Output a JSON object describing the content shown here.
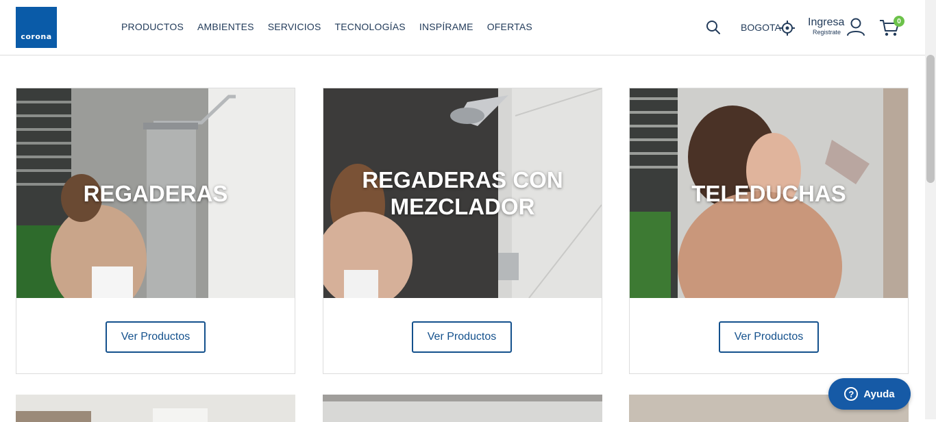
{
  "brand": {
    "logo_text": "corona",
    "color": "#0a5ba8"
  },
  "nav": [
    {
      "label": "PRODUCTOS"
    },
    {
      "label": "AMBIENTES"
    },
    {
      "label": "SERVICIOS"
    },
    {
      "label": "TECNOLOGÍAS"
    },
    {
      "label": "INSPÍRAME"
    },
    {
      "label": "OFERTAS"
    }
  ],
  "header": {
    "city": "BOGOTA",
    "login_label": "Ingresa",
    "register_label": "Registrate",
    "cart_count": "0",
    "icons": [
      "search-icon",
      "location-target-icon",
      "user-icon",
      "cart-icon"
    ]
  },
  "cards": [
    {
      "title": "REGADERAS",
      "button": "Ver Productos"
    },
    {
      "title": "REGADERAS CON MEZCLADOR",
      "button": "Ver Productos"
    },
    {
      "title": "TELEDUCHAS",
      "button": "Ver Productos"
    }
  ],
  "help": {
    "label": "Ayuda",
    "icon": "question-icon"
  },
  "colors": {
    "accent": "#13508c",
    "badge": "#6cc24a",
    "help_bg": "#165aa6"
  }
}
